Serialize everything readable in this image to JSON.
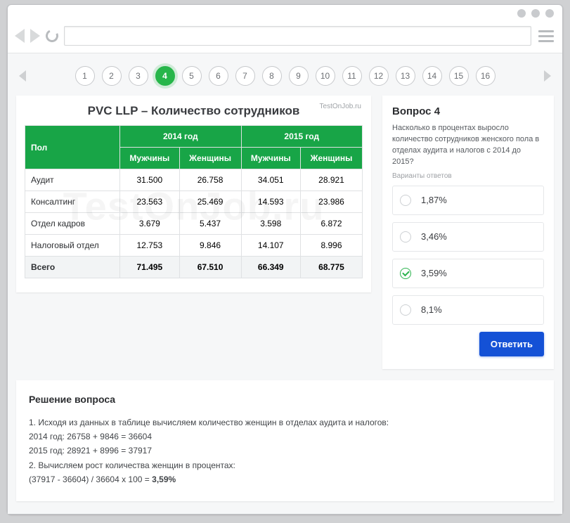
{
  "pager": {
    "count": 16,
    "active": 4
  },
  "table": {
    "title": "PVC LLP – Количество сотрудников",
    "watermark_small": "TestOnJob.ru",
    "watermark_big": "TestOnJob.ru",
    "years": [
      "2014 год",
      "2015 год"
    ],
    "pol": "Пол",
    "col_men": "Мужчины",
    "col_women": "Женщины",
    "rows": [
      {
        "label": "Аудит",
        "v": [
          "31.500",
          "26.758",
          "34.051",
          "28.921"
        ]
      },
      {
        "label": "Консалтинг",
        "v": [
          "23.563",
          "25.469",
          "14.593",
          "23.986"
        ]
      },
      {
        "label": "Отдел кадров",
        "v": [
          "3.679",
          "5.437",
          "3.598",
          "6.872"
        ]
      },
      {
        "label": "Налоговый отдел",
        "v": [
          "12.753",
          "9.846",
          "14.107",
          "8.996"
        ]
      }
    ],
    "total": {
      "label": "Всего",
      "v": [
        "71.495",
        "67.510",
        "66.349",
        "68.775"
      ]
    }
  },
  "question": {
    "title": "Вопрос 4",
    "text": "Насколько в процентах выросло количество сотрудников женского пола в отделах аудита и налогов с 2014 до 2015?",
    "variants_label": "Варианты ответов",
    "answers": [
      {
        "label": "1,87%",
        "selected": false
      },
      {
        "label": "3,46%",
        "selected": false
      },
      {
        "label": "3,59%",
        "selected": true
      },
      {
        "label": "8,1%",
        "selected": false
      }
    ],
    "submit": "Ответить"
  },
  "solution": {
    "title": "Решение вопроса",
    "line1": "1. Исходя из данных в таблице вычисляем количество женщин в отделах аудита и налогов:",
    "line2": "2014 год: 26758 + 9846 = 36604",
    "line3": "2015 год: 28921 + 8996 = 37917",
    "line4": "2. Вычисляем рост количества женщин в процентах:",
    "line5_pre": "(37917 - 36604) / 36604 x 100 = ",
    "line5_bold": "3,59%"
  }
}
